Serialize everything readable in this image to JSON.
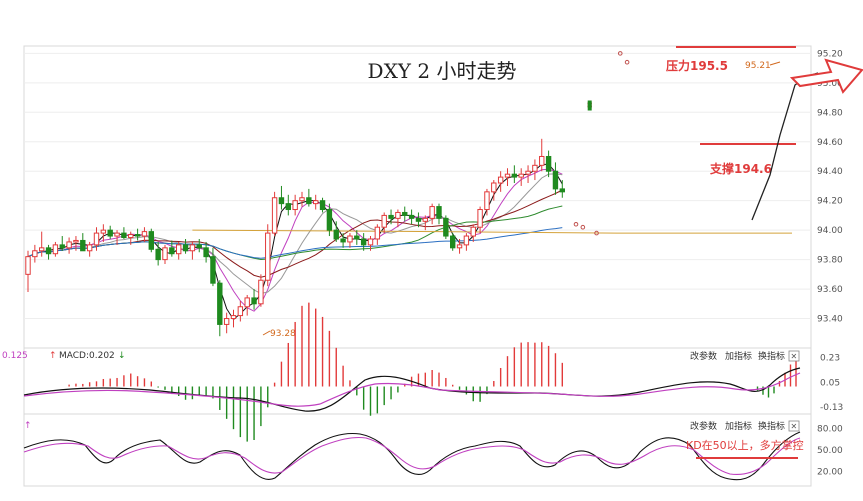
{
  "chart_data": {
    "type": "candlestick",
    "title": "DXY 2 小时走势",
    "price_axis": {
      "ticks": [
        "95.20",
        "95.00",
        "94.80",
        "94.60",
        "94.40",
        "94.20",
        "94.00",
        "93.80",
        "93.60",
        "93.40"
      ],
      "ylim": [
        93.2,
        95.25
      ]
    },
    "annotations": {
      "resistance": "压力195.5",
      "support": "支撑194.6",
      "high_label": "95.21",
      "low_label": "93.28",
      "kd_note": "KD在50以上，多方掌控"
    },
    "colors": {
      "up": "#e23a3a",
      "down": "#1f8a1f",
      "ma_black": "#111111",
      "ma_purple": "#c040c0",
      "ma_gray": "#999999",
      "ma_darkred": "#8b1a1a",
      "ma_green": "#2e8b2e",
      "ma_blue": "#2b6fc2",
      "ma_orange": "#d4a23a",
      "annotation": "#e03b3b"
    },
    "candles": [
      {
        "o": 93.7,
        "h": 93.86,
        "l": 93.58,
        "c": 93.82
      },
      {
        "o": 93.82,
        "h": 93.9,
        "l": 93.78,
        "c": 93.86
      },
      {
        "o": 93.86,
        "h": 93.99,
        "l": 93.82,
        "c": 93.88
      },
      {
        "o": 93.88,
        "h": 93.9,
        "l": 93.8,
        "c": 93.84
      },
      {
        "o": 93.84,
        "h": 93.92,
        "l": 93.82,
        "c": 93.9
      },
      {
        "o": 93.9,
        "h": 93.96,
        "l": 93.86,
        "c": 93.88
      },
      {
        "o": 93.88,
        "h": 93.95,
        "l": 93.84,
        "c": 93.92
      },
      {
        "o": 93.92,
        "h": 93.96,
        "l": 93.86,
        "c": 93.93
      },
      {
        "o": 93.93,
        "h": 93.98,
        "l": 93.88,
        "c": 93.86
      },
      {
        "o": 93.86,
        "h": 93.92,
        "l": 93.82,
        "c": 93.9
      },
      {
        "o": 93.9,
        "h": 94.02,
        "l": 93.86,
        "c": 93.98
      },
      {
        "o": 93.98,
        "h": 94.04,
        "l": 93.92,
        "c": 94.0
      },
      {
        "o": 94.0,
        "h": 94.03,
        "l": 93.94,
        "c": 93.96
      },
      {
        "o": 93.96,
        "h": 94.0,
        "l": 93.9,
        "c": 93.98
      },
      {
        "o": 93.98,
        "h": 94.02,
        "l": 93.94,
        "c": 93.95
      },
      {
        "o": 93.95,
        "h": 93.99,
        "l": 93.9,
        "c": 93.97
      },
      {
        "o": 93.97,
        "h": 94.01,
        "l": 93.93,
        "c": 93.96
      },
      {
        "o": 93.96,
        "h": 94.02,
        "l": 93.92,
        "c": 93.99
      },
      {
        "o": 93.99,
        "h": 94.01,
        "l": 93.85,
        "c": 93.87
      },
      {
        "o": 93.87,
        "h": 93.92,
        "l": 93.76,
        "c": 93.8
      },
      {
        "o": 93.8,
        "h": 93.9,
        "l": 93.77,
        "c": 93.88
      },
      {
        "o": 93.88,
        "h": 93.93,
        "l": 93.82,
        "c": 93.84
      },
      {
        "o": 93.84,
        "h": 93.92,
        "l": 93.8,
        "c": 93.9
      },
      {
        "o": 93.9,
        "h": 93.94,
        "l": 93.84,
        "c": 93.86
      },
      {
        "o": 93.86,
        "h": 93.92,
        "l": 93.8,
        "c": 93.9
      },
      {
        "o": 93.9,
        "h": 93.94,
        "l": 93.85,
        "c": 93.88
      },
      {
        "o": 93.88,
        "h": 93.92,
        "l": 93.78,
        "c": 93.82
      },
      {
        "o": 93.82,
        "h": 93.88,
        "l": 93.62,
        "c": 93.64
      },
      {
        "o": 93.64,
        "h": 93.66,
        "l": 93.28,
        "c": 93.36
      },
      {
        "o": 93.36,
        "h": 93.44,
        "l": 93.3,
        "c": 93.4
      },
      {
        "o": 93.4,
        "h": 93.46,
        "l": 93.34,
        "c": 93.42
      },
      {
        "o": 93.42,
        "h": 93.52,
        "l": 93.38,
        "c": 93.48
      },
      {
        "o": 93.48,
        "h": 93.56,
        "l": 93.42,
        "c": 93.54
      },
      {
        "o": 93.54,
        "h": 93.6,
        "l": 93.46,
        "c": 93.5
      },
      {
        "o": 93.5,
        "h": 93.7,
        "l": 93.48,
        "c": 93.66
      },
      {
        "o": 93.66,
        "h": 94.04,
        "l": 93.62,
        "c": 93.98
      },
      {
        "o": 93.98,
        "h": 94.26,
        "l": 93.96,
        "c": 94.22
      },
      {
        "o": 94.22,
        "h": 94.3,
        "l": 94.14,
        "c": 94.18
      },
      {
        "o": 94.18,
        "h": 94.24,
        "l": 94.1,
        "c": 94.14
      },
      {
        "o": 94.14,
        "h": 94.24,
        "l": 94.1,
        "c": 94.2
      },
      {
        "o": 94.2,
        "h": 94.26,
        "l": 94.16,
        "c": 94.22
      },
      {
        "o": 94.22,
        "h": 94.28,
        "l": 94.16,
        "c": 94.18
      },
      {
        "o": 94.18,
        "h": 94.24,
        "l": 94.14,
        "c": 94.2
      },
      {
        "o": 94.2,
        "h": 94.22,
        "l": 94.12,
        "c": 94.14
      },
      {
        "o": 94.14,
        "h": 94.18,
        "l": 93.96,
        "c": 94.0
      },
      {
        "o": 94.0,
        "h": 94.06,
        "l": 93.92,
        "c": 93.94
      },
      {
        "o": 93.94,
        "h": 93.98,
        "l": 93.88,
        "c": 93.92
      },
      {
        "o": 93.92,
        "h": 93.98,
        "l": 93.88,
        "c": 93.96
      },
      {
        "o": 93.96,
        "h": 94.0,
        "l": 93.9,
        "c": 93.94
      },
      {
        "o": 93.94,
        "h": 93.98,
        "l": 93.86,
        "c": 93.9
      },
      {
        "o": 93.9,
        "h": 93.96,
        "l": 93.86,
        "c": 93.94
      },
      {
        "o": 93.94,
        "h": 94.04,
        "l": 93.9,
        "c": 94.02
      },
      {
        "o": 94.02,
        "h": 94.12,
        "l": 93.98,
        "c": 94.1
      },
      {
        "o": 94.1,
        "h": 94.14,
        "l": 94.04,
        "c": 94.08
      },
      {
        "o": 94.08,
        "h": 94.14,
        "l": 94.02,
        "c": 94.12
      },
      {
        "o": 94.12,
        "h": 94.16,
        "l": 94.06,
        "c": 94.1
      },
      {
        "o": 94.1,
        "h": 94.14,
        "l": 94.04,
        "c": 94.08
      },
      {
        "o": 94.08,
        "h": 94.12,
        "l": 94.02,
        "c": 94.06
      },
      {
        "o": 94.06,
        "h": 94.1,
        "l": 94.0,
        "c": 94.08
      },
      {
        "o": 94.08,
        "h": 94.18,
        "l": 94.04,
        "c": 94.16
      },
      {
        "o": 94.16,
        "h": 94.18,
        "l": 94.04,
        "c": 94.08
      },
      {
        "o": 94.08,
        "h": 94.1,
        "l": 93.94,
        "c": 93.96
      },
      {
        "o": 93.96,
        "h": 93.98,
        "l": 93.86,
        "c": 93.88
      },
      {
        "o": 93.88,
        "h": 93.94,
        "l": 93.84,
        "c": 93.9
      },
      {
        "o": 93.9,
        "h": 93.98,
        "l": 93.86,
        "c": 93.96
      },
      {
        "o": 93.96,
        "h": 94.04,
        "l": 93.92,
        "c": 94.02
      },
      {
        "o": 94.02,
        "h": 94.16,
        "l": 93.98,
        "c": 94.14
      },
      {
        "o": 94.14,
        "h": 94.28,
        "l": 94.1,
        "c": 94.26
      },
      {
        "o": 94.26,
        "h": 94.34,
        "l": 94.2,
        "c": 94.32
      },
      {
        "o": 94.32,
        "h": 94.4,
        "l": 94.26,
        "c": 94.36
      },
      {
        "o": 94.36,
        "h": 94.42,
        "l": 94.3,
        "c": 94.38
      },
      {
        "o": 94.38,
        "h": 94.44,
        "l": 94.32,
        "c": 94.36
      },
      {
        "o": 94.36,
        "h": 94.42,
        "l": 94.3,
        "c": 94.38
      },
      {
        "o": 94.38,
        "h": 94.44,
        "l": 94.32,
        "c": 94.4
      },
      {
        "o": 94.4,
        "h": 94.48,
        "l": 94.34,
        "c": 94.44
      },
      {
        "o": 94.44,
        "h": 94.62,
        "l": 94.4,
        "c": 94.5
      },
      {
        "o": 94.5,
        "h": 94.54,
        "l": 94.36,
        "c": 94.4
      },
      {
        "o": 94.4,
        "h": 94.46,
        "l": 94.24,
        "c": 94.28
      },
      {
        "o": 94.28,
        "h": 94.34,
        "l": 94.22,
        "c": 94.26
      }
    ],
    "gap_points": [
      {
        "i": 82,
        "v": 94.86
      },
      {
        "i": 82,
        "v": 94.84
      },
      {
        "i": 80,
        "v": 94.04
      },
      {
        "i": 81,
        "v": 94.02
      },
      {
        "i": 83,
        "v": 93.98
      },
      {
        "i": 85,
        "v": 95.2
      },
      {
        "i": 86,
        "v": 95.14
      }
    ],
    "macd": {
      "label_left": "0.125",
      "label": "MACD:0.202",
      "ticks": [
        "0.23",
        "0.05",
        "-0.13"
      ],
      "ylim": [
        -0.18,
        0.3
      ]
    },
    "kd": {
      "ticks": [
        "80.00",
        "50.00",
        "20.00"
      ],
      "ylim": [
        0,
        100
      ]
    },
    "panel_buttons": [
      "改参数",
      "加指标",
      "换指标"
    ],
    "close_glyph": "✕"
  }
}
